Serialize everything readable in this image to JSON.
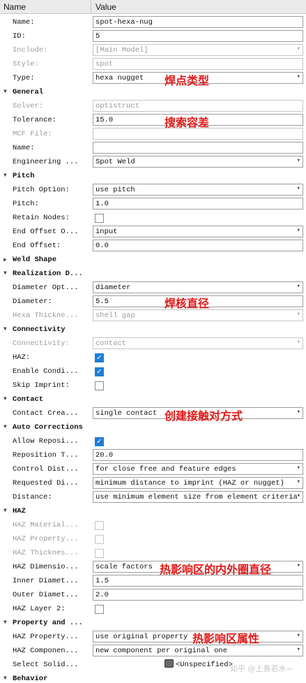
{
  "header": {
    "name": "Name",
    "value": "Value"
  },
  "rows": [
    {
      "kind": "text",
      "label": "Name:",
      "value": "spot-hexa-nug"
    },
    {
      "kind": "text",
      "label": "ID:",
      "value": "5"
    },
    {
      "kind": "combo",
      "label": "Include:",
      "value": "[Main Model]",
      "disabled": true
    },
    {
      "kind": "text",
      "label": "Style:",
      "value": "spot",
      "disabled": true
    },
    {
      "kind": "combo",
      "label": "Type:",
      "value": "hexa nugget"
    },
    {
      "kind": "group",
      "label": "General",
      "expanded": true
    },
    {
      "kind": "text",
      "label": "Solver:",
      "value": "optistruct",
      "disabled": true
    },
    {
      "kind": "text",
      "label": "Tolerance:",
      "value": "15.0"
    },
    {
      "kind": "text",
      "label": "MCF File:",
      "value": "",
      "disabled": true
    },
    {
      "kind": "text",
      "label": "Name:",
      "value": ""
    },
    {
      "kind": "combo",
      "label": "Engineering ...",
      "value": "Spot Weld"
    },
    {
      "kind": "group",
      "label": "Pitch",
      "expanded": true
    },
    {
      "kind": "combo",
      "label": "Pitch Option:",
      "value": "use pitch"
    },
    {
      "kind": "text",
      "label": "Pitch:",
      "value": "1.0"
    },
    {
      "kind": "check",
      "label": "Retain Nodes:",
      "checked": false
    },
    {
      "kind": "combo",
      "label": "End Offset O...",
      "value": "input"
    },
    {
      "kind": "text",
      "label": "End Offset:",
      "value": "0.0"
    },
    {
      "kind": "group",
      "label": "Weld Shape",
      "expanded": false
    },
    {
      "kind": "group",
      "label": "Realization D...",
      "expanded": true
    },
    {
      "kind": "combo",
      "label": "Diameter Opt...",
      "value": "diameter"
    },
    {
      "kind": "text",
      "label": "Diameter:",
      "value": "5.5"
    },
    {
      "kind": "combo",
      "label": "Hexa Thickne...",
      "value": "shell gap",
      "disabled": true
    },
    {
      "kind": "group",
      "label": "Connectivity",
      "expanded": true
    },
    {
      "kind": "combo",
      "label": "Connectivity:",
      "value": "contact",
      "disabled": true
    },
    {
      "kind": "check",
      "label": "HAZ:",
      "checked": true
    },
    {
      "kind": "check",
      "label": "Enable Condi...",
      "checked": true
    },
    {
      "kind": "check",
      "label": "Skip Imprint:",
      "checked": false
    },
    {
      "kind": "group",
      "label": "Contact",
      "expanded": true
    },
    {
      "kind": "combo",
      "label": "Contact Crea...",
      "value": "single contact"
    },
    {
      "kind": "group",
      "label": "Auto Corrections",
      "expanded": true
    },
    {
      "kind": "check",
      "label": "Allow Reposi...",
      "checked": true
    },
    {
      "kind": "text",
      "label": "Reposition T...",
      "value": "20.0"
    },
    {
      "kind": "combo",
      "label": "Control Dist...",
      "value": "for close free and feature edges"
    },
    {
      "kind": "combo",
      "label": "Requested Di...",
      "value": "minimum distance to imprint (HAZ or nugget)"
    },
    {
      "kind": "combo",
      "label": "Distance:",
      "value": "use minimum element size from element criteria"
    },
    {
      "kind": "group",
      "label": "HAZ",
      "expanded": true
    },
    {
      "kind": "check",
      "label": "HAZ Material...",
      "checked": false,
      "disabled": true
    },
    {
      "kind": "check",
      "label": "HAZ Property...",
      "checked": false,
      "disabled": true
    },
    {
      "kind": "check",
      "label": "HAZ Thicknes...",
      "checked": false,
      "disabled": true
    },
    {
      "kind": "combo",
      "label": "HAZ Dimensio...",
      "value": "scale factors"
    },
    {
      "kind": "text",
      "label": "Inner Diamet...",
      "value": "1.5"
    },
    {
      "kind": "text",
      "label": "Outer Diamet...",
      "value": "2.0"
    },
    {
      "kind": "check",
      "label": "HAZ Layer 2:",
      "checked": false
    },
    {
      "kind": "group",
      "label": "Property and ...",
      "expanded": true
    },
    {
      "kind": "combo",
      "label": "HAZ Property...",
      "value": "use original property"
    },
    {
      "kind": "combo",
      "label": "HAZ Componen...",
      "value": "new component per original one"
    },
    {
      "kind": "entity",
      "label": "Select Solid...",
      "value": "<Unspecified>"
    },
    {
      "kind": "group",
      "label": "Behavior",
      "expanded": true
    }
  ],
  "annotations": {
    "type": "焊点类型",
    "tolerance": "搜索容差",
    "diameter": "焊核直径",
    "contact": "创建接触对方式",
    "haz_dimension": "热影响区的内外圈直径",
    "haz_property": "热影响区属性"
  },
  "watermark": "知乎 @上善若水~",
  "colors": {
    "annotation": "#e21a1a",
    "checkbox": "#1e7fd6",
    "header": "#eaeaea"
  },
  "icons": {
    "expanded": "triangle-down-icon",
    "collapsed": "triangle-right-icon",
    "combo": "chevron-down-icon",
    "entity": "solid-cube-icon"
  }
}
